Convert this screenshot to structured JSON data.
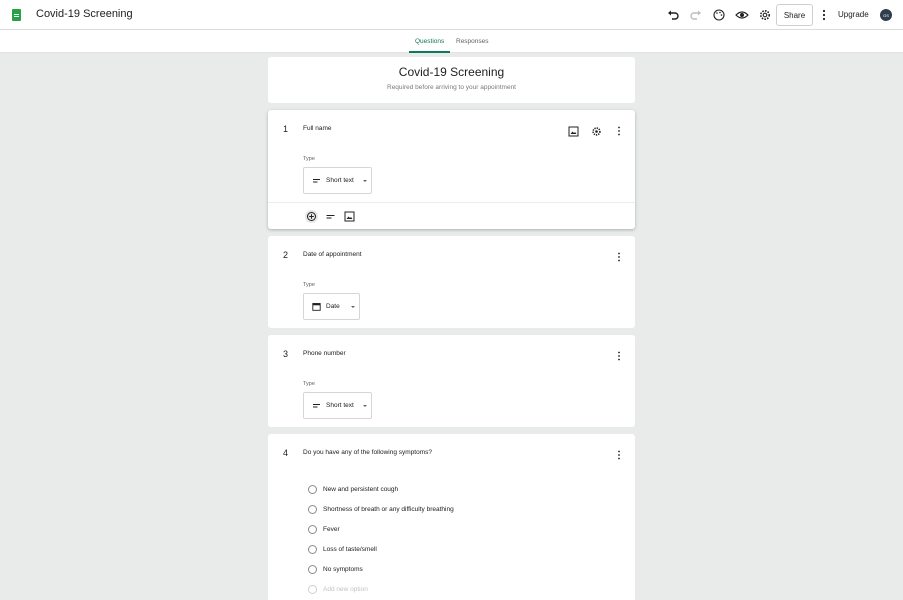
{
  "app": {
    "title": "Covid-19 Screening",
    "share_label": "Share",
    "upgrade_label": "Upgrade",
    "avatar_initials": "GS"
  },
  "tabs": [
    {
      "label": "Questions",
      "active": true
    },
    {
      "label": "Responses",
      "active": false
    }
  ],
  "form_header": {
    "title": "Covid-19 Screening",
    "description": "Required before arriving to your appointment"
  },
  "type_label": "Type",
  "questions": [
    {
      "number": "1",
      "text": "Full name",
      "type": "Short text",
      "type_icon": "short-text-icon"
    },
    {
      "number": "2",
      "text": "Date of appointment",
      "type": "Date",
      "type_icon": "calendar-icon"
    },
    {
      "number": "3",
      "text": "Phone number",
      "type": "Short text",
      "type_icon": "short-text-icon"
    },
    {
      "number": "4",
      "text": "Do you have any of the following symptoms?",
      "options": [
        "New and persistent cough",
        "Shortness of breath or any difficulty breathing",
        "Fever",
        "Loss of taste/smell",
        "No symptoms"
      ],
      "add_option_placeholder": "Add new option"
    }
  ],
  "colors": {
    "accent": "#0c7a5a",
    "logo_green": "#27a146",
    "background": "#e8ebea"
  }
}
